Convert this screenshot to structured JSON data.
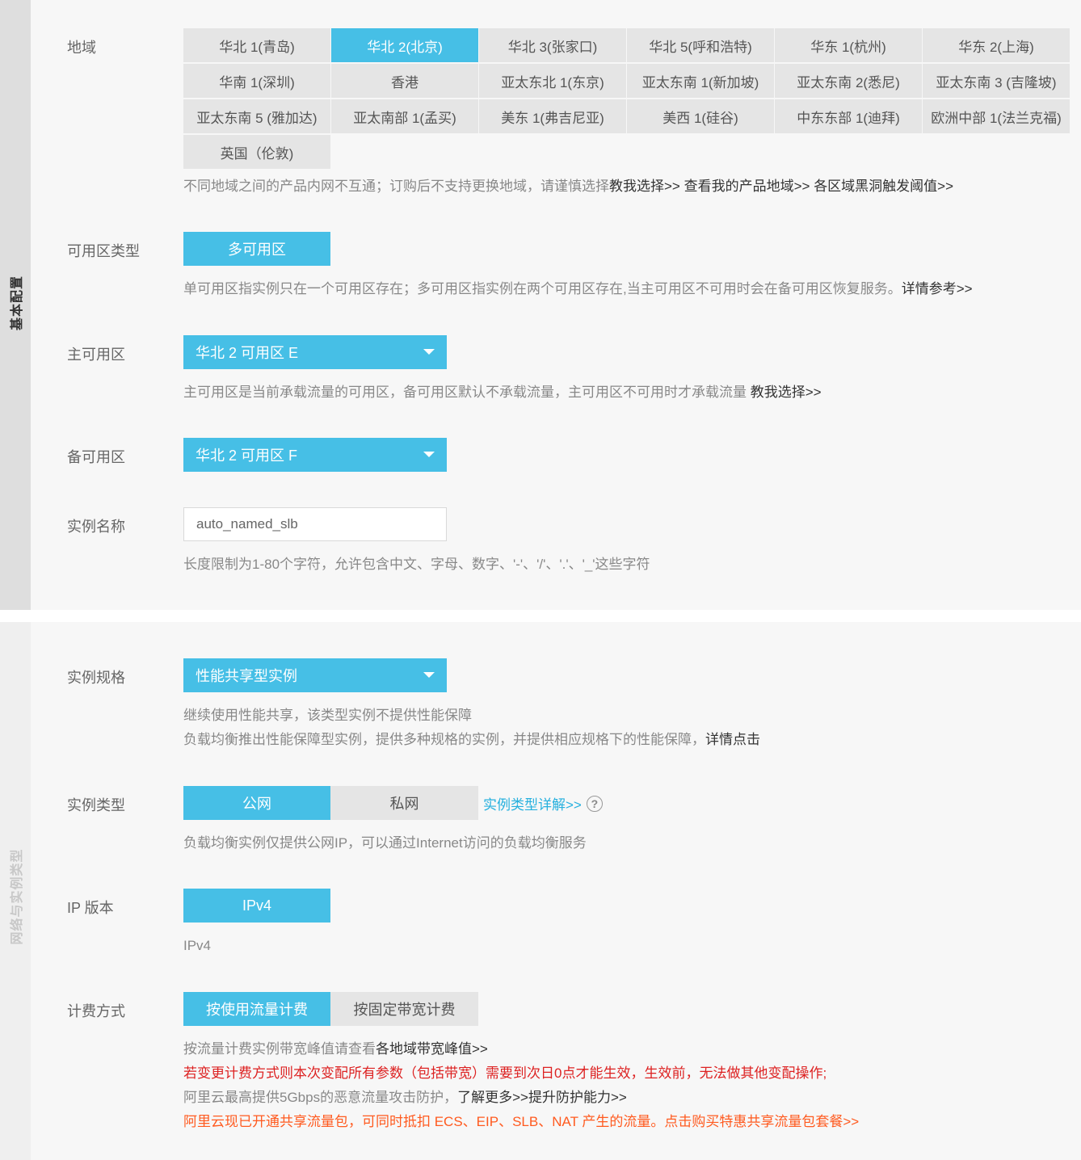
{
  "sections": {
    "basic": "基本配置",
    "network": "网络与实例类型"
  },
  "region": {
    "label": "地域",
    "options": [
      "华北 1(青岛)",
      "华北 2(北京)",
      "华北 3(张家口)",
      "华北 5(呼和浩特)",
      "华东 1(杭州)",
      "华东 2(上海)",
      "华南 1(深圳)",
      "香港",
      "亚太东北 1(东京)",
      "亚太东南 1(新加坡)",
      "亚太东南 2(悉尼)",
      "亚太东南 3 (吉隆坡)",
      "亚太东南 5 (雅加达)",
      "亚太南部 1(孟买)",
      "美东 1(弗吉尼亚)",
      "美西 1(硅谷)",
      "中东东部 1(迪拜)",
      "欧洲中部 1(法兰克福)",
      "英国（伦敦)"
    ],
    "selected": "华北 2(北京)",
    "help_text": "不同地域之间的产品内网不互通；订购后不支持更换地域，请谨慎选择",
    "link_teach": "教我选择>>",
    "link_my_regions": "查看我的产品地域>>",
    "link_blackhole": "各区域黑洞触发阈值>>"
  },
  "zone_type": {
    "label": "可用区类型",
    "button": "多可用区",
    "help_text": "单可用区指实例只在一个可用区存在；多可用区指实例在两个可用区存在,当主可用区不可用时会在备可用区恢复服务。",
    "help_link": "详情参考>>"
  },
  "primary_zone": {
    "label": "主可用区",
    "value": "华北 2 可用区 E",
    "help_text": "主可用区是当前承载流量的可用区，备可用区默认不承载流量，主可用区不可用时才承载流量 ",
    "help_link": "教我选择>>"
  },
  "backup_zone": {
    "label": "备可用区",
    "value": "华北 2 可用区 F"
  },
  "instance_name": {
    "label": "实例名称",
    "value": "auto_named_slb",
    "help_text": "长度限制为1-80个字符，允许包含中文、字母、数字、'-'、'/'、'.'、'_'这些字符"
  },
  "instance_spec": {
    "label": "实例规格",
    "value": "性能共享型实例",
    "help_line1": "继续使用性能共享，该类型实例不提供性能保障",
    "help_line2": "负载均衡推出性能保障型实例，提供多种规格的实例，并提供相应规格下的性能保障，",
    "help_link": "详情点击"
  },
  "instance_type": {
    "label": "实例类型",
    "options": [
      "公网",
      "私网"
    ],
    "selected": "公网",
    "detail_link": "实例类型详解>>",
    "help_icon": "question-circle-icon",
    "help_text": "负载均衡实例仅提供公网IP，可以通过Internet访问的负载均衡服务"
  },
  "ip_version": {
    "label": "IP 版本",
    "button": "IPv4",
    "help_text": "IPv4"
  },
  "billing": {
    "label": "计费方式",
    "options": [
      "按使用流量计费",
      "按固定带宽计费"
    ],
    "selected": "按使用流量计费",
    "line1_text": "按流量计费实例带宽峰值请查看",
    "line1_link": "各地域带宽峰值>>",
    "line2": "若变更计费方式则本次变配所有参数（包括带宽）需要到次日0点才能生效，生效前，无法做其他变配操作;",
    "line3_text": "阿里云最高提供5Gbps的恶意流量攻击防护，",
    "line3_link1": "了解更多>>",
    "line3_link2": "提升防护能力>>",
    "line4": "阿里云现已开通共享流量包，可同时抵扣 ECS、EIP、SLB、NAT 产生的流量。点击购买特惠共享流量包套餐>>"
  },
  "colors": {
    "accent": "#46bfe6",
    "link": "#26b0de",
    "warning_red": "#dd2222",
    "promo_orange": "#ff5a1f"
  }
}
